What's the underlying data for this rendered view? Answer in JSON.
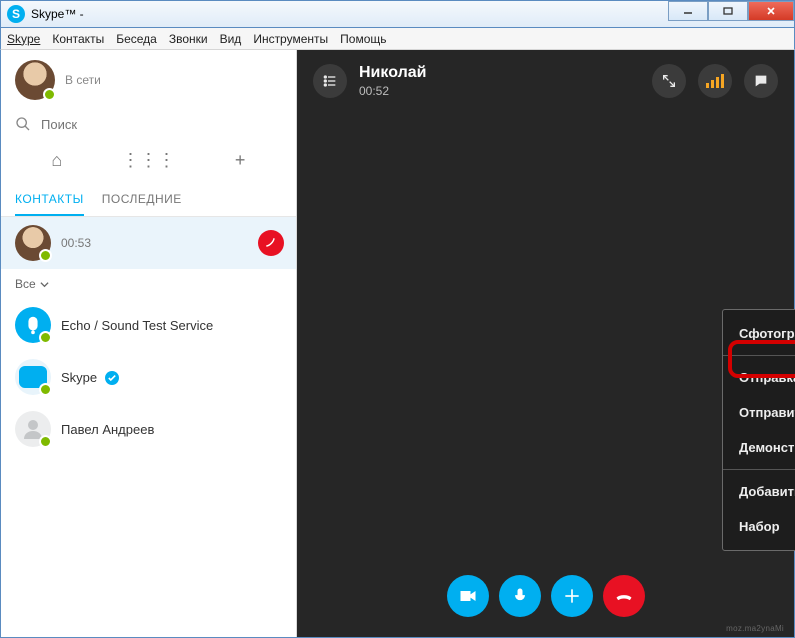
{
  "window": {
    "title": "Skype™ -"
  },
  "menubar": [
    "Skype",
    "Контакты",
    "Беседа",
    "Звонки",
    "Вид",
    "Инструменты",
    "Помощь"
  ],
  "profile": {
    "name": "",
    "status": "В сети"
  },
  "search": {
    "placeholder": "Поиск"
  },
  "tabs": {
    "contacts": "КОНТАКТЫ",
    "recent": "ПОСЛЕДНИЕ"
  },
  "active_call": {
    "name": "",
    "duration": "00:53"
  },
  "filter": {
    "label": "Все"
  },
  "contacts": [
    {
      "name": "Echo / Sound Test Service",
      "verified": false
    },
    {
      "name": "Skype",
      "verified": true
    },
    {
      "name": "Павел Андреев",
      "verified": false
    }
  ],
  "call": {
    "peer": "Николай",
    "duration": "00:52"
  },
  "popup": {
    "items": [
      "Сфотографировать...",
      "Отправка файлов...",
      "Отправить контакты...",
      "Демонстрация экрана...",
      "Добавить участников к этому звонку...",
      "Набор"
    ]
  },
  "watermark": "moz.ma2ynaMi"
}
